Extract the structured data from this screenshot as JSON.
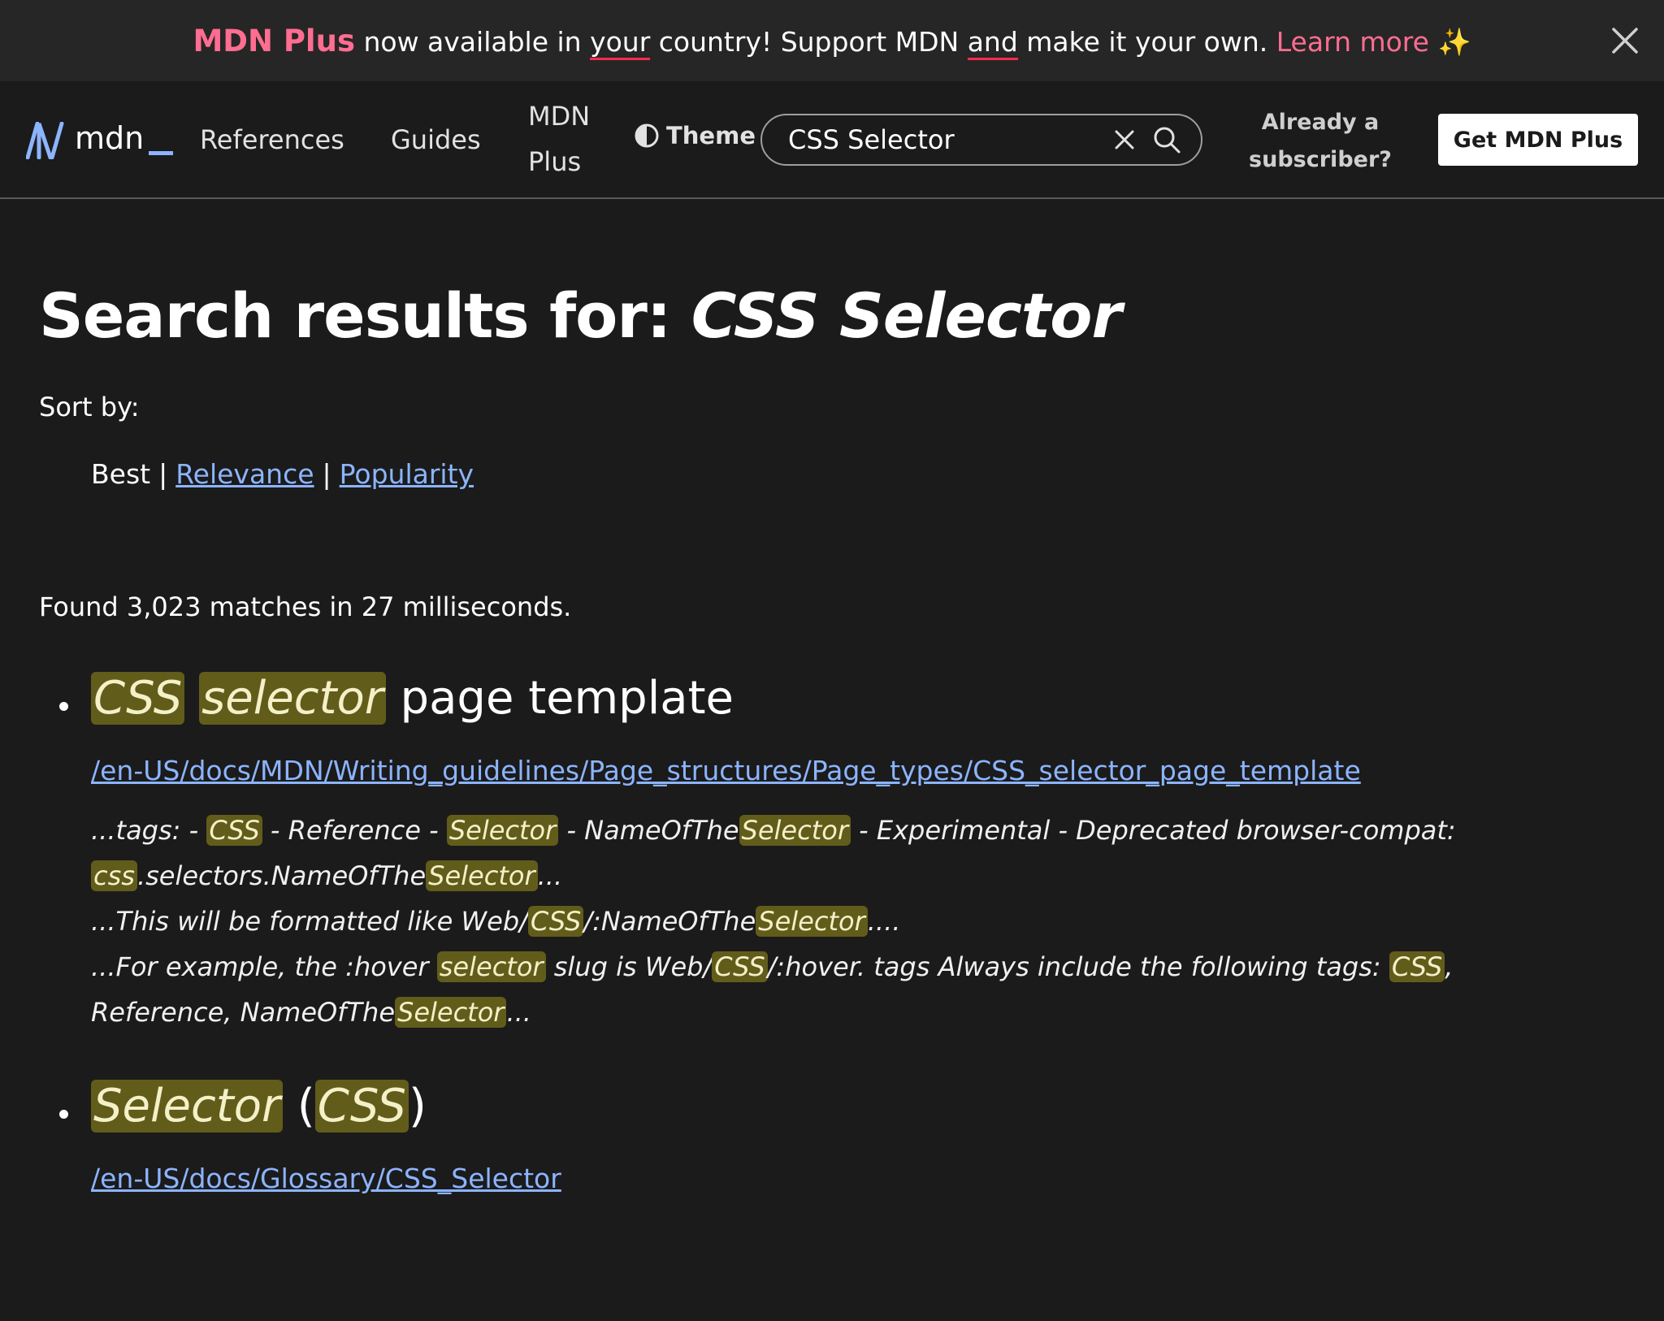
{
  "banner": {
    "plus_label": "MDN Plus",
    "text_1": " now available in ",
    "text_your": "your",
    "text_2": " country! Support MDN ",
    "text_and": "and",
    "text_3": " make it your own. ",
    "learn_more": "Learn more",
    "sparkle": "✨"
  },
  "header": {
    "logo_text": "mdn",
    "nav": [
      "References",
      "Guides",
      "MDN",
      "Plus"
    ],
    "theme_label": "Theme",
    "search_value": "CSS Selector",
    "subscriber_line1": "Already a",
    "subscriber_line2": "subscriber?",
    "get_plus": "Get MDN Plus"
  },
  "page": {
    "heading_prefix": "Search results for: ",
    "heading_query": "CSS Selector",
    "sort_label": "Sort by:",
    "sort_best": "Best",
    "sort_sep": "|",
    "sort_relevance": "Relevance",
    "sort_popularity": "Popularity",
    "found": "Found 3,023 matches in 27 milliseconds."
  },
  "results": [
    {
      "title_hl1": "CSS",
      "title_hl2": "selector",
      "title_rest": " page template",
      "url": "/en-US/docs/MDN/Writing_guidelines/Page_structures/Page_types/CSS_selector_page_template",
      "snippet": [
        {
          "t": "...tags: - "
        },
        {
          "h": "CSS"
        },
        {
          "t": " - Reference - "
        },
        {
          "h": "Selector"
        },
        {
          "t": " - NameOfThe"
        },
        {
          "h": "Selector"
        },
        {
          "t": " - Experimental - Deprecated browser-compat: "
        },
        {
          "h": "css"
        },
        {
          "t": ".selectors.NameOfThe"
        },
        {
          "h": "Selector"
        },
        {
          "t": "..."
        },
        {
          "br": true
        },
        {
          "t": "...This will be formatted like Web/"
        },
        {
          "h": "CSS"
        },
        {
          "t": "/:NameOfThe"
        },
        {
          "h": "Selector"
        },
        {
          "t": "...."
        },
        {
          "br": true
        },
        {
          "t": "...For example, the :hover "
        },
        {
          "h": "selector"
        },
        {
          "t": " slug is Web/"
        },
        {
          "h": "CSS"
        },
        {
          "t": "/:hover. tags Always include the following tags: "
        },
        {
          "h": "CSS"
        },
        {
          "t": ", Reference, NameOfThe"
        },
        {
          "h": "Selector"
        },
        {
          "t": "..."
        }
      ]
    },
    {
      "title_hl1": "Selector",
      "title_mid": " (",
      "title_hl2": "CSS",
      "title_end": ")",
      "url": "/en-US/docs/Glossary/CSS_Selector"
    }
  ]
}
